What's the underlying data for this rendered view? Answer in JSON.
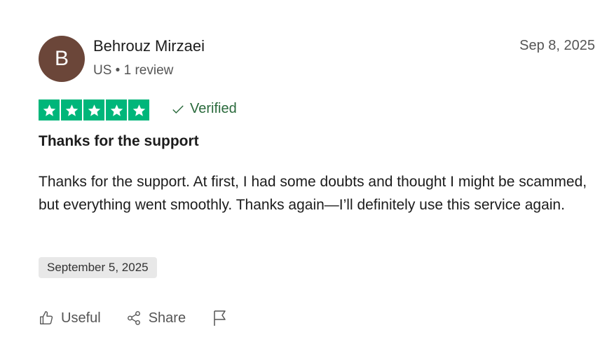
{
  "reviewer": {
    "avatar_initial": "B",
    "avatar_color": "#6b4639",
    "name": "Behrouz Mirzaei",
    "meta": "US • 1 review"
  },
  "review_date": "Sep 8, 2025",
  "rating": {
    "stars": 5,
    "max": 5,
    "color": "#00b67a",
    "verified_label": "Verified"
  },
  "review": {
    "title": "Thanks for the support",
    "body": "Thanks for the support. At first, I had some doubts and thought I might be scammed, but everything went smoothly. Thanks again—I’ll definitely use this service again.",
    "experience_date": "September 5, 2025"
  },
  "actions": {
    "useful_label": "Useful",
    "share_label": "Share",
    "flag_icon": "flag-icon"
  }
}
